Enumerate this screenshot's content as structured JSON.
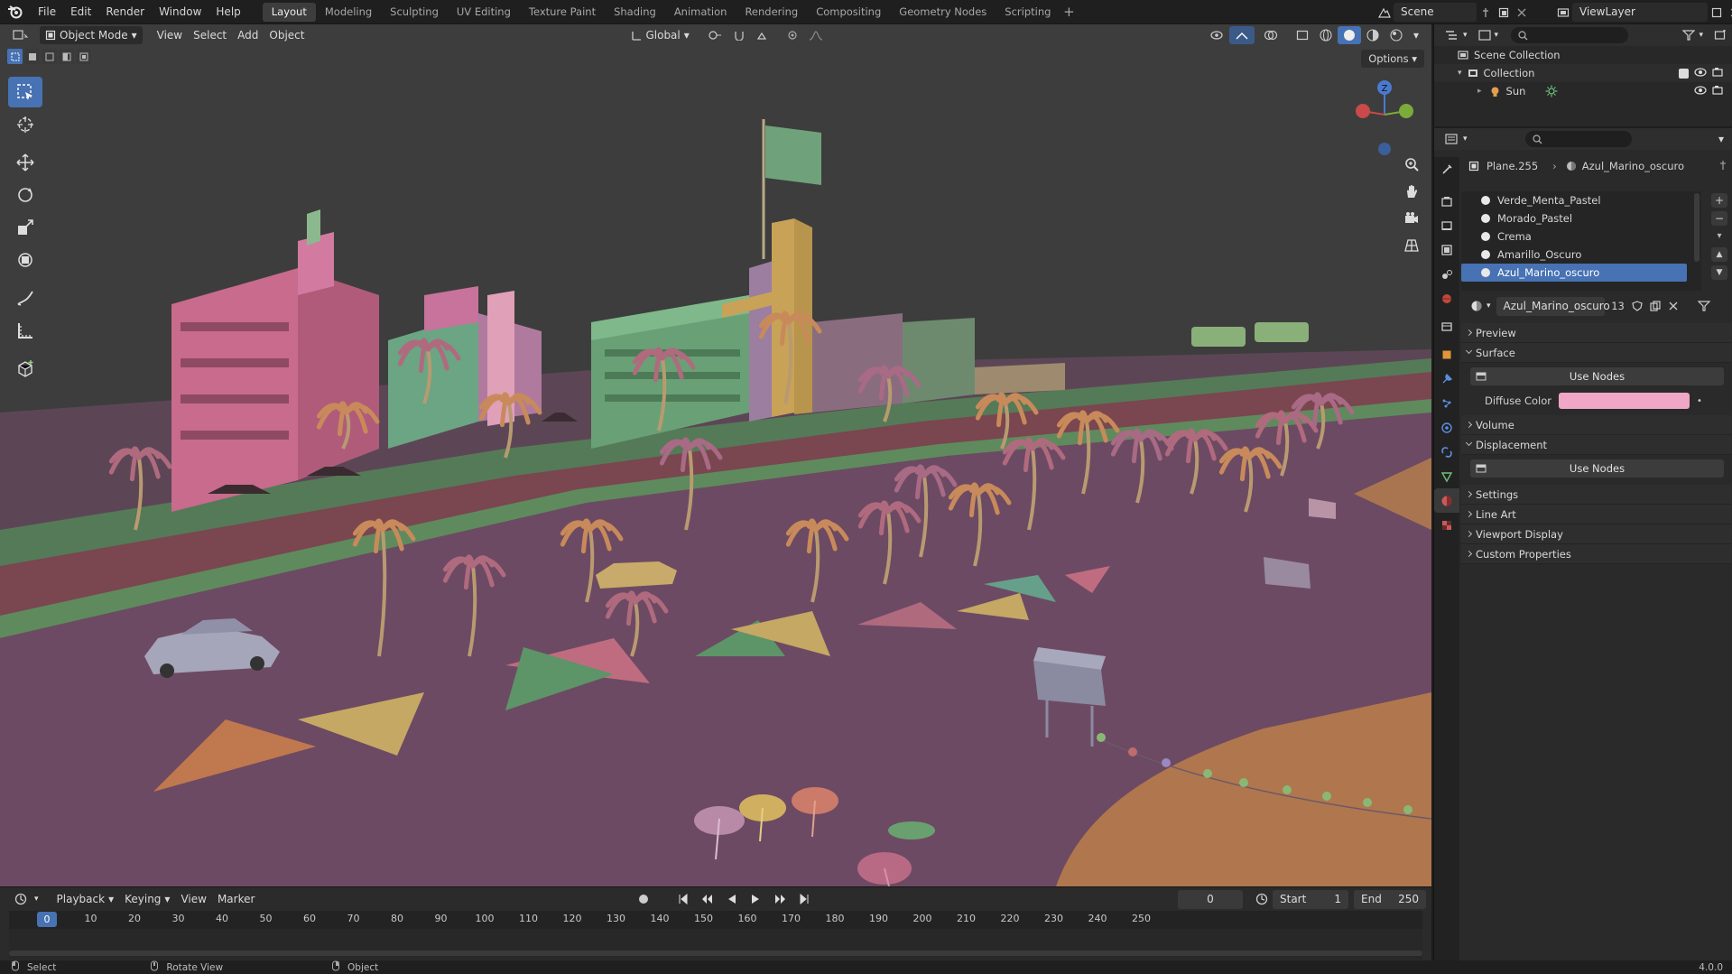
{
  "app": {
    "menu": [
      "File",
      "Edit",
      "Render",
      "Window",
      "Help"
    ],
    "workspaces": [
      "Layout",
      "Modeling",
      "Sculpting",
      "UV Editing",
      "Texture Paint",
      "Shading",
      "Animation",
      "Rendering",
      "Compositing",
      "Geometry Nodes",
      "Scripting"
    ],
    "active_workspace": "Layout",
    "scene_name": "Scene",
    "view_layer": "ViewLayer",
    "version": "4.0.0"
  },
  "viewport": {
    "mode": "Object Mode",
    "menus": [
      "View",
      "Select",
      "Add",
      "Object"
    ],
    "transform_orientation": "Global",
    "options_label": "Options",
    "gizmo_axes": {
      "z": "Z"
    }
  },
  "timeline": {
    "menus": [
      "Playback",
      "Keying",
      "View",
      "Marker"
    ],
    "current_frame": "0",
    "start_label": "Start",
    "start": "1",
    "end_label": "End",
    "end": "250",
    "ticks": [
      "0",
      "10",
      "20",
      "30",
      "40",
      "50",
      "60",
      "70",
      "80",
      "90",
      "100",
      "110",
      "120",
      "130",
      "140",
      "150",
      "160",
      "170",
      "180",
      "190",
      "200",
      "210",
      "220",
      "230",
      "240",
      "250"
    ],
    "playhead": "0"
  },
  "status": {
    "select": "Select",
    "rotate": "Rotate View",
    "object": "Object"
  },
  "outliner": {
    "scene_collection": "Scene Collection",
    "collection": "Collection",
    "sun": "Sun"
  },
  "properties": {
    "object": "Plane.255",
    "material": "Azul_Marino_oscuro",
    "slots": [
      "Verde_Menta_Pastel",
      "Morado_Pastel",
      "Crema",
      "Amarillo_Oscuro",
      "Azul_Marino_oscuro"
    ],
    "selected_slot": "Azul_Marino_oscuro",
    "material_users": "13",
    "panels": {
      "preview": "Preview",
      "surface": "Surface",
      "use_nodes": "Use Nodes",
      "diffuse_label": "Diffuse Color",
      "diffuse_color": "#f0a6c6",
      "volume": "Volume",
      "displacement": "Displacement",
      "use_nodes_2": "Use Nodes",
      "settings": "Settings",
      "line_art": "Line Art",
      "viewport_display": "Viewport Display",
      "custom_properties": "Custom Properties"
    }
  },
  "colors": {
    "accent": "#4772b3",
    "ground": "#6d4a63",
    "sand": "#b0764e",
    "road": "#7a4650",
    "grass": "#557a57"
  }
}
